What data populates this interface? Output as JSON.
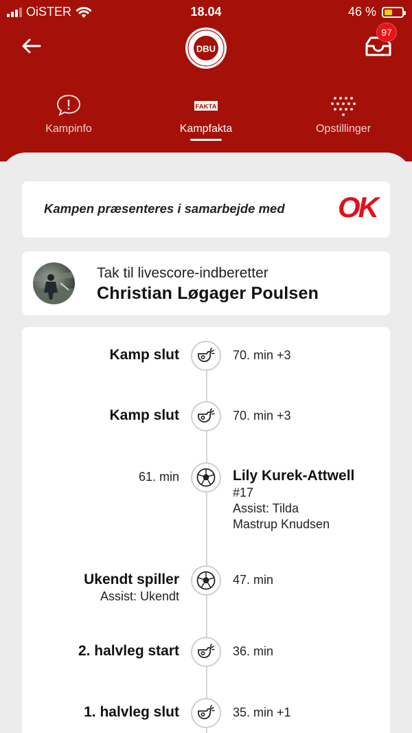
{
  "status_bar": {
    "carrier": "OiSTER",
    "time": "18.04",
    "battery_text": "46 %",
    "battery_level": 0.46
  },
  "header": {
    "notification_count": "97",
    "logo_text": "DBU"
  },
  "tabs": [
    {
      "label": "Kampinfo",
      "icon": "alert-bubble-icon",
      "active": false
    },
    {
      "label": "Kampfakta",
      "icon": "fakta-icon",
      "icon_text": "FAKTA",
      "active": true
    },
    {
      "label": "Opstillinger",
      "icon": "lineup-dots-icon",
      "active": false
    }
  ],
  "sponsor": {
    "text": "Kampen præsenteres i samarbejde med",
    "logo_text": "OK"
  },
  "reporter": {
    "label": "Tak til livescore-indberetter",
    "name": "Christian Løgager Poulsen"
  },
  "events": [
    {
      "side": "left",
      "title": "Kamp slut",
      "time": "70. min +3",
      "icon": "whistle-icon"
    },
    {
      "side": "left",
      "title": "Kamp slut",
      "time": "70. min +3",
      "icon": "whistle-icon"
    },
    {
      "side": "right",
      "title": "Lily Kurek-Attwell",
      "number": "#17",
      "assist_line1": "Assist: Tilda",
      "assist_line2": "Mastrup Knudsen",
      "time": "61. min",
      "icon": "football-icon"
    },
    {
      "side": "left",
      "title": "Ukendt spiller",
      "assist": "Assist: Ukendt",
      "time": "47. min",
      "icon": "football-icon"
    },
    {
      "side": "left",
      "title": "2. halvleg start",
      "time": "36. min",
      "icon": "whistle-icon"
    },
    {
      "side": "left",
      "title": "1. halvleg slut",
      "time": "35. min +1",
      "icon": "whistle-icon"
    }
  ],
  "colors": {
    "brand_red": "#a51008",
    "badge_red": "#e8141a",
    "ok_red": "#e2101a",
    "battery_yellow": "#f5d10a"
  }
}
